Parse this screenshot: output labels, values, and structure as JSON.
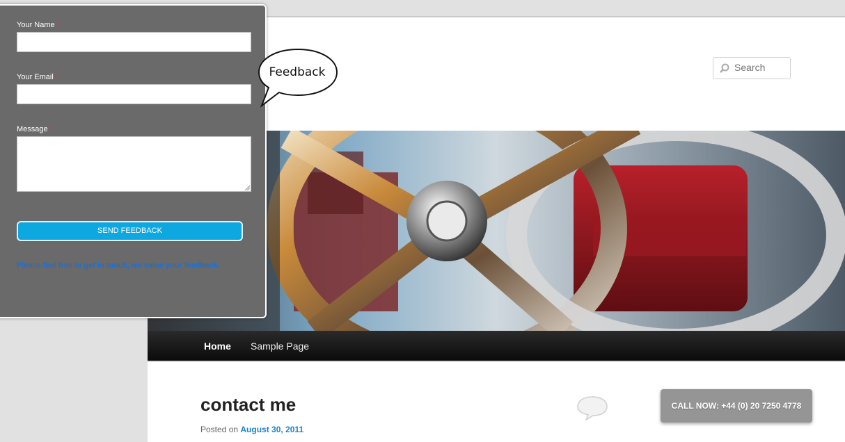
{
  "feedback_form": {
    "name_label": "Your Name",
    "email_label": "Your Email",
    "message_label": "Message",
    "required_mark": "*",
    "name_value": "",
    "email_value": "",
    "message_value": "",
    "send_button": "SEND FEEDBACK",
    "note": "Please feel free to get in touch, we value your feedback.",
    "tab_label": "Feedback"
  },
  "search": {
    "placeholder": "Search",
    "icon": "search-icon"
  },
  "nav": {
    "items": [
      {
        "label": "Home"
      },
      {
        "label": "Sample Page"
      }
    ]
  },
  "post": {
    "title": "contact me",
    "posted_prefix": "Posted on",
    "date": "August 30, 2011"
  },
  "call_button": {
    "label": "CALL NOW: +44 (0) 20 7250 4778"
  },
  "colors": {
    "accent": "#0ea8e0",
    "link": "#1982d1",
    "panel": "#6a6a6a"
  }
}
